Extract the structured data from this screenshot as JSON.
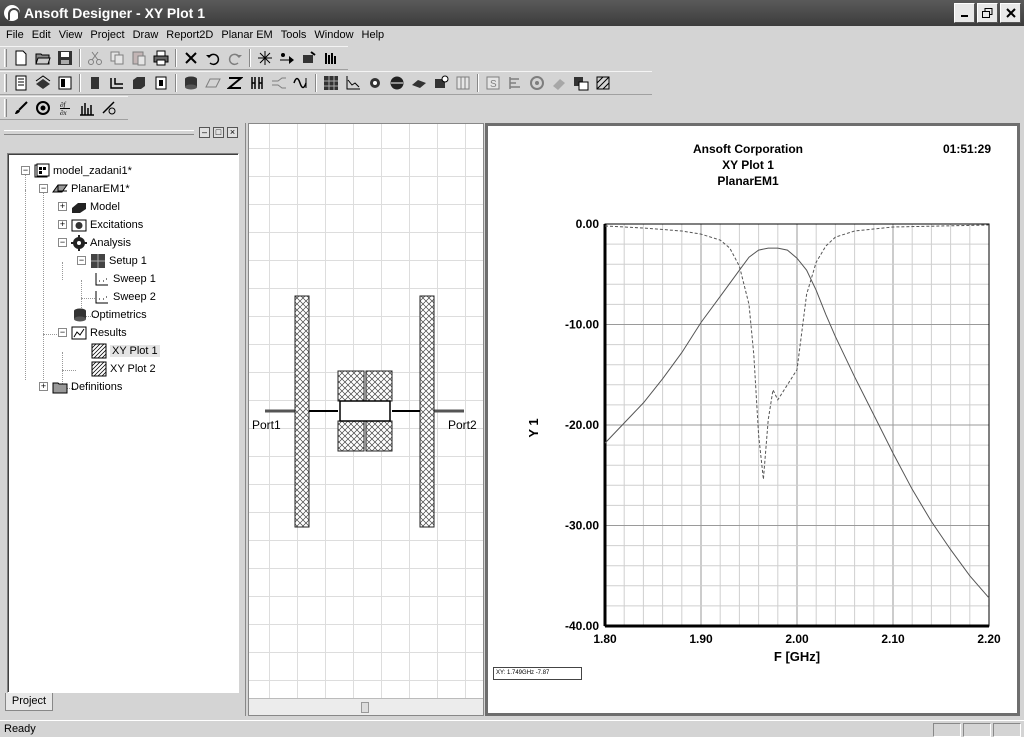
{
  "window": {
    "title": "Ansoft Designer  - XY Plot 1"
  },
  "menu": [
    "File",
    "Edit",
    "View",
    "Project",
    "Draw",
    "Report2D",
    "Planar EM",
    "Tools",
    "Window",
    "Help"
  ],
  "tree": {
    "project": "model_zadani1*",
    "design": "PlanarEM1*",
    "model": "Model",
    "excitations": "Excitations",
    "analysis": "Analysis",
    "setup": "Setup 1",
    "sweep1": "Sweep 1",
    "sweep2": "Sweep 2",
    "optimetrics": "Optimetrics",
    "results": "Results",
    "plot1": "XY Plot 1",
    "plot2": "XY Plot 2",
    "definitions": "Definitions"
  },
  "project_tab": "Project",
  "layout": {
    "port1": "Port1",
    "port2": "Port2"
  },
  "plot": {
    "company": "Ansoft Corporation",
    "name": "XY Plot 1",
    "design": "PlanarEM1",
    "time": "01:51:29",
    "cursor_readout": "XY: 1.749GHz -7.87"
  },
  "chart_data": {
    "type": "line",
    "xlabel": "F [GHz]",
    "ylabel": "Y 1",
    "xlim": [
      1.8,
      2.2
    ],
    "ylim": [
      -40,
      0
    ],
    "xticks": [
      "1.80",
      "1.90",
      "2.00",
      "2.10",
      "2.20"
    ],
    "yticks": [
      "0.00",
      "-10.00",
      "-20.00",
      "-30.00",
      "-40.00"
    ],
    "grid": true,
    "series": [
      {
        "style": "solid",
        "x": [
          1.8,
          1.82,
          1.84,
          1.86,
          1.88,
          1.9,
          1.92,
          1.94,
          1.95,
          1.96,
          1.97,
          1.98,
          1.99,
          2.0,
          2.01,
          2.02,
          2.03,
          2.04,
          2.06,
          2.08,
          2.1,
          2.12,
          2.14,
          2.16,
          2.18,
          2.2
        ],
        "y": [
          -21.8,
          -19.8,
          -17.8,
          -15.4,
          -12.8,
          -9.8,
          -7.2,
          -4.6,
          -3.3,
          -2.6,
          -2.4,
          -2.4,
          -2.6,
          -3.4,
          -4.6,
          -6.6,
          -9.0,
          -11.2,
          -15.2,
          -19.0,
          -22.8,
          -26.4,
          -29.6,
          -32.4,
          -35.0,
          -37.2
        ]
      },
      {
        "style": "dashed",
        "x": [
          1.8,
          1.84,
          1.88,
          1.9,
          1.92,
          1.93,
          1.94,
          1.95,
          1.955,
          1.96,
          1.965,
          1.97,
          1.975,
          1.98,
          1.99,
          2.0,
          2.01,
          2.02,
          2.03,
          2.04,
          2.06,
          2.1,
          2.15,
          2.2
        ],
        "y": [
          -0.2,
          -0.4,
          -0.7,
          -1.0,
          -1.6,
          -2.4,
          -4.2,
          -8.0,
          -13.0,
          -21.0,
          -25.4,
          -19.5,
          -16.5,
          -17.5,
          -16.0,
          -14.5,
          -7.0,
          -3.8,
          -2.2,
          -1.3,
          -0.7,
          -0.3,
          -0.2,
          -0.1
        ]
      }
    ]
  },
  "status": {
    "text": "Ready"
  }
}
